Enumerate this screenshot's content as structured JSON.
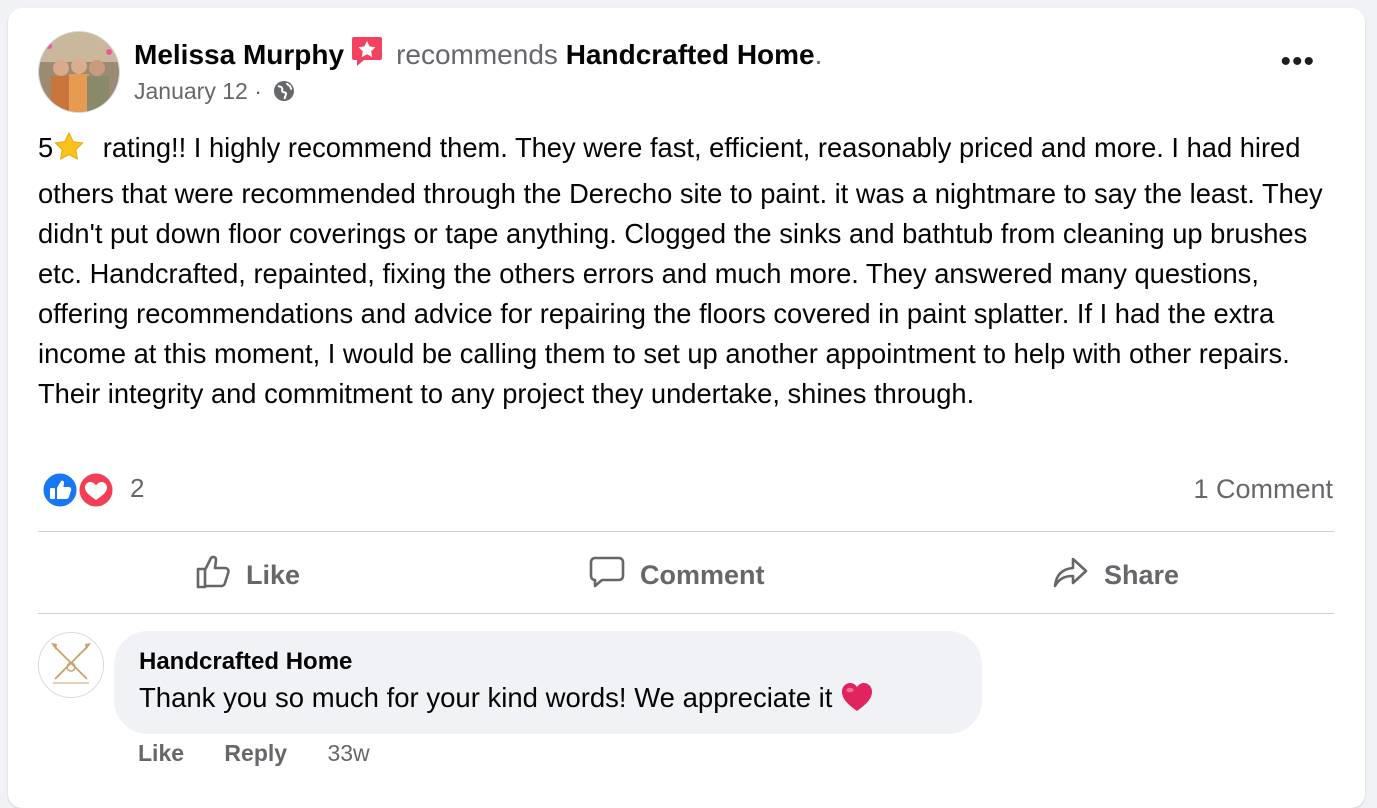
{
  "post": {
    "author": "Melissa Murphy",
    "recommends_text": "recommends",
    "page_name": "Handcrafted Home",
    "period": ".",
    "date": "January 12",
    "separator": "·",
    "audience_icon": "globe-icon",
    "badge_icon": "recommendation-star-badge-icon",
    "rating_prefix": "5",
    "body": " rating!! I highly recommend them. They were fast, efficient, reasonably priced and more. I had hired others that were recommended through the Derecho site to paint. it was a nightmare to say the least. They didn't put down floor coverings or tape anything. Clogged the sinks and bathtub from cleaning up brushes etc. Handcrafted, repainted, fixing the others errors and much more. They answered many questions, offering recommendations and advice for repairing the floors covered in paint splatter. If I had the extra income at this moment, I would be calling them to set up another appointment to help with other repairs. Their integrity and commitment to any project they undertake, shines through.",
    "more_label": "•••"
  },
  "reactions": {
    "count": "2",
    "icons": [
      "like-reaction-icon",
      "love-reaction-icon"
    ],
    "comments_count": "1 Comment"
  },
  "actions": {
    "like": "Like",
    "comment": "Comment",
    "share": "Share"
  },
  "comment": {
    "author": "Handcrafted Home",
    "text": "Thank you so much for your kind words! We appreciate it",
    "like": "Like",
    "reply": "Reply",
    "age": "33w"
  },
  "colors": {
    "like_blue": "#1877f2",
    "love_red": "#f33e58",
    "badge_pink": "#f3425f",
    "text_secondary": "#65676b"
  }
}
